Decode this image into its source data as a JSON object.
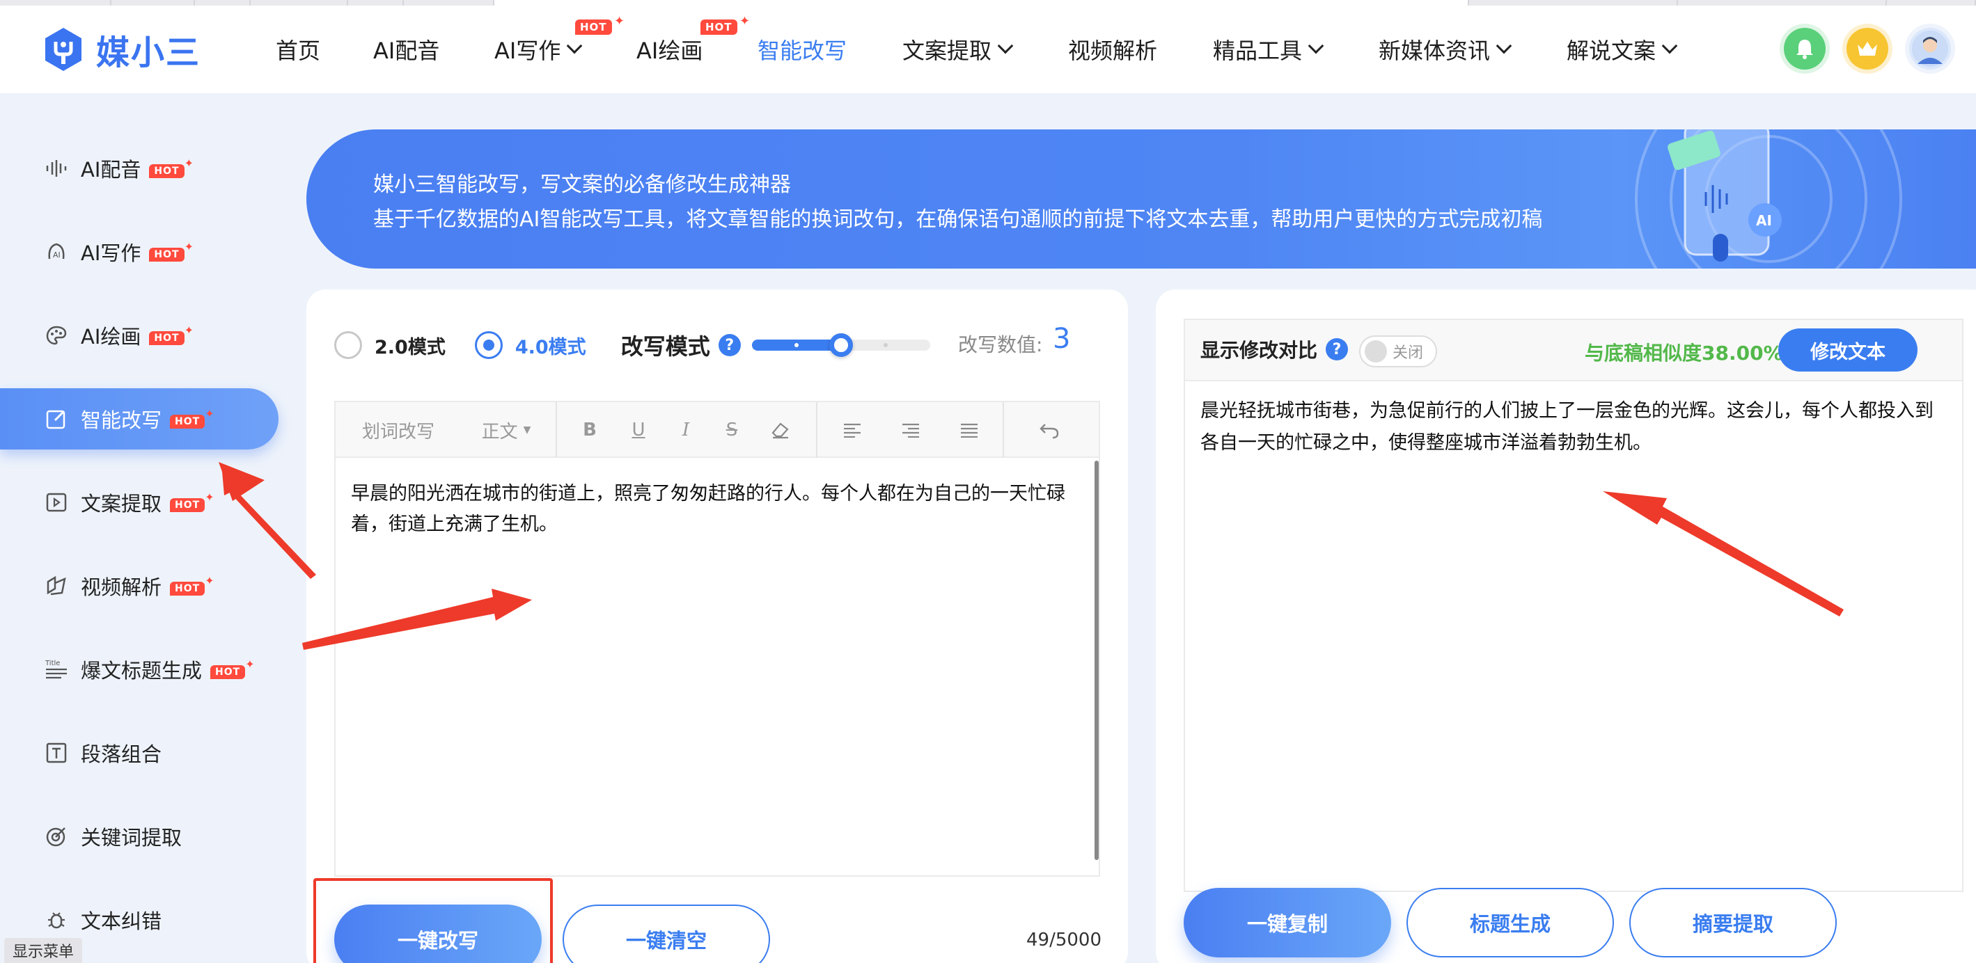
{
  "brand": {
    "name": "媒小三",
    "accent": "#3a7df0",
    "hot_color": "#ff4a3d"
  },
  "nav": {
    "items": [
      {
        "label": "首页",
        "dropdown": false,
        "hot": false,
        "active": false
      },
      {
        "label": "AI配音",
        "dropdown": false,
        "hot": false,
        "active": false
      },
      {
        "label": "AI写作",
        "dropdown": true,
        "hot": true,
        "active": false
      },
      {
        "label": "AI绘画",
        "dropdown": false,
        "hot": true,
        "active": false
      },
      {
        "label": "智能改写",
        "dropdown": false,
        "hot": false,
        "active": true
      },
      {
        "label": "文案提取",
        "dropdown": true,
        "hot": false,
        "active": false
      },
      {
        "label": "视频解析",
        "dropdown": false,
        "hot": false,
        "active": false
      },
      {
        "label": "精品工具",
        "dropdown": true,
        "hot": false,
        "active": false
      },
      {
        "label": "新媒体资讯",
        "dropdown": true,
        "hot": false,
        "active": false
      },
      {
        "label": "解说文案",
        "dropdown": true,
        "hot": false,
        "active": false
      }
    ],
    "hot_label": "HOT",
    "icons": [
      "bell-icon",
      "crown-icon",
      "avatar"
    ]
  },
  "sidebar": {
    "items": [
      {
        "label": "AI配音",
        "icon": "audio-wave-icon",
        "hot": true,
        "active": false
      },
      {
        "label": "AI写作",
        "icon": "ai-write-icon",
        "hot": true,
        "active": false
      },
      {
        "label": "AI绘画",
        "icon": "palette-icon",
        "hot": true,
        "active": false
      },
      {
        "label": "智能改写",
        "icon": "edit-icon",
        "hot": true,
        "active": true
      },
      {
        "label": "文案提取",
        "icon": "video-extract-icon",
        "hot": true,
        "active": false
      },
      {
        "label": "视频解析",
        "icon": "video-parse-icon",
        "hot": true,
        "active": false
      },
      {
        "label": "爆文标题生成",
        "icon": "title-icon",
        "hot": true,
        "active": false
      },
      {
        "label": "段落组合",
        "icon": "text-box-icon",
        "hot": false,
        "active": false
      },
      {
        "label": "关键词提取",
        "icon": "target-icon",
        "hot": false,
        "active": false
      },
      {
        "label": "文本纠错",
        "icon": "bug-icon",
        "hot": false,
        "active": false
      }
    ],
    "hot_label": "HOT",
    "footer_tab": "显示菜单"
  },
  "banner": {
    "title": "媒小三智能改写，写文案的必备修改生成神器",
    "description": "基于千亿数据的AI智能改写工具，将文章智能的换词改句，在确保语句通顺的前提下将文本去重，帮助用户更快的方式完成初稿"
  },
  "editor": {
    "modes": [
      {
        "label": "2.0模式",
        "selected": false
      },
      {
        "label": "4.0模式",
        "selected": true
      }
    ],
    "rewrite_mode_label": "改写模式",
    "rewrite_value_label": "改写数值:",
    "rewrite_value": "3",
    "rewrite_level_fraction": 0.5,
    "toolbar": {
      "phrase_rewrite": "划词改写",
      "paragraph_style": "正文",
      "icons": [
        "bold-icon",
        "underline-icon",
        "italic-icon",
        "strikethrough-icon",
        "eraser-icon",
        "align-left-icon",
        "align-right-icon",
        "align-justify-icon",
        "undo-icon"
      ]
    },
    "text": "早晨的阳光洒在城市的街道上，照亮了匆匆赶路的行人。每个人都在为自己的一天忙碌着，街道上充满了生机。",
    "rewrite_button": "一键改写",
    "clear_button": "一键清空",
    "char_count": "49/5000"
  },
  "result": {
    "compare_label": "显示修改对比",
    "toggle_label": "关闭",
    "similarity": "与底稿相似度38.00%",
    "edit_button": "修改文本",
    "text": "晨光轻抚城市街巷，为急促前行的人们披上了一层金色的光辉。这会儿，每个人都投入到各自一天的忙碌之中，使得整座城市洋溢着勃勃生机。",
    "copy_button": "一键复制",
    "title_button": "标题生成",
    "summary_button": "摘要提取"
  }
}
